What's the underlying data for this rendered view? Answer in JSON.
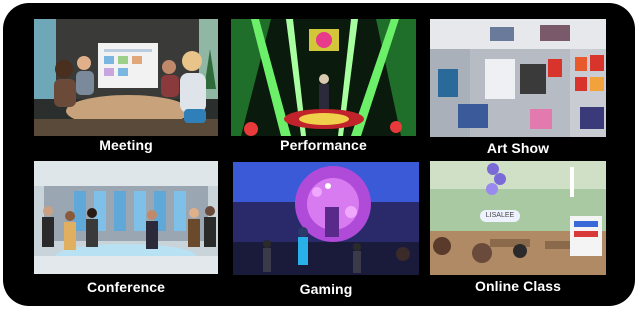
{
  "tiles": [
    {
      "label": "Meeting"
    },
    {
      "label": "Performance"
    },
    {
      "label": "Art Show"
    },
    {
      "label": "Conference"
    },
    {
      "label": "Gaming"
    },
    {
      "label": "Online Class"
    }
  ],
  "scene_text": {
    "class_sign": "LISALEE"
  },
  "colors": {
    "panel_bg": "#000000",
    "label_text": "#ffffff"
  }
}
